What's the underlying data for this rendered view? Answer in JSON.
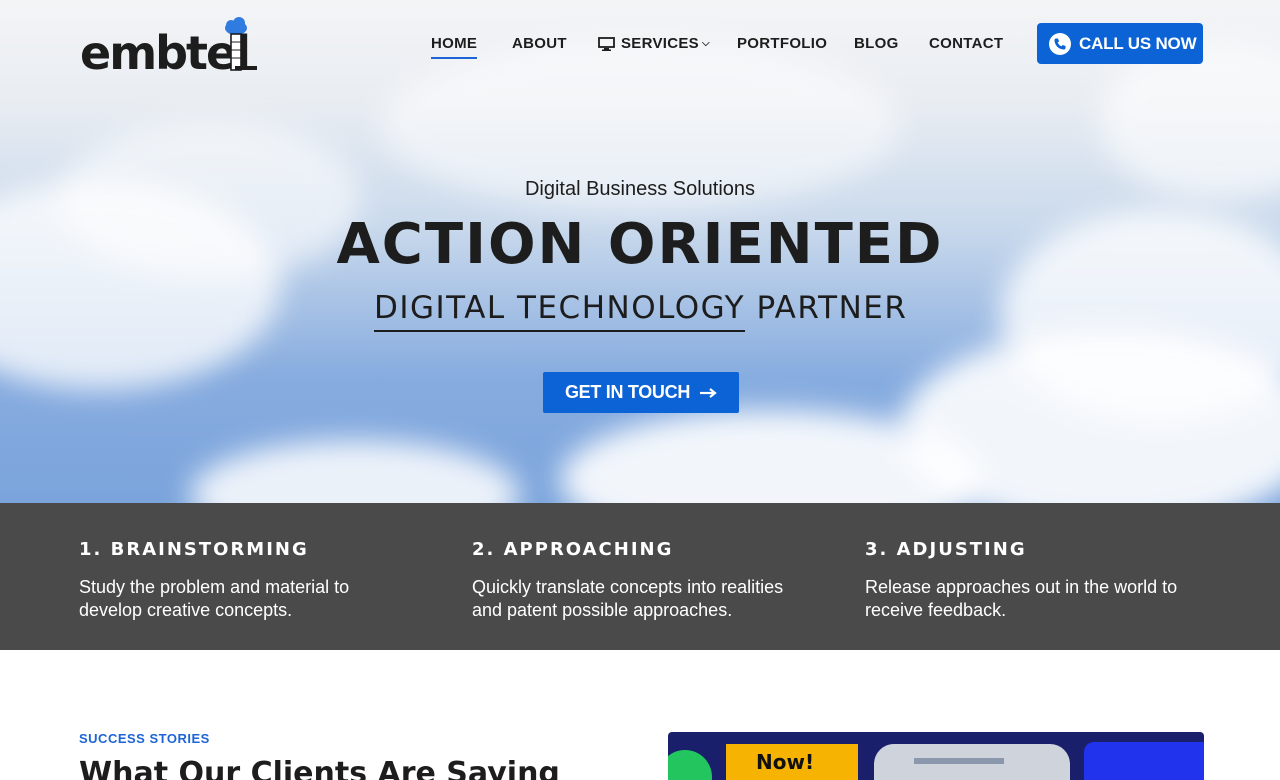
{
  "brand": {
    "name": "embtel"
  },
  "nav": {
    "items": [
      {
        "label": "HOME",
        "active": true
      },
      {
        "label": "ABOUT"
      },
      {
        "label": "SERVICES",
        "icon": "monitor-icon",
        "has_dropdown": true
      },
      {
        "label": "PORTFOLIO"
      },
      {
        "label": "BLOG"
      },
      {
        "label": "CONTACT"
      }
    ],
    "cta_label": "CALL US NOW",
    "cta_icon": "phone-icon"
  },
  "hero": {
    "subtitle": "Digital Business Solutions",
    "title": "ACTION ORIENTED",
    "line2_highlight": "DIGITAL TECHNOLOGY",
    "line2_rest": "PARTNER",
    "button_label": "GET IN TOUCH",
    "button_icon": "arrow-right-icon"
  },
  "steps": [
    {
      "title": "1. BRAINSTORMING",
      "desc_line1": "Study the problem and material to",
      "desc_line2": "develop creative concepts."
    },
    {
      "title": "2. APPROACHING",
      "desc_line1": "Quickly translate concepts into realities",
      "desc_line2": "and patent possible approaches."
    },
    {
      "title": "3. ADJUSTING",
      "desc_line1": "Release approaches out in the world to",
      "desc_line2": "receive feedback."
    }
  ],
  "testimonials": {
    "kicker": "SUCCESS STORIES",
    "title": "What Our Clients Are Saying",
    "media_caption": "Now!"
  },
  "colors": {
    "accent": "#0b63d6",
    "dark_band": "#4a4a4a",
    "text": "#1d1d1d"
  }
}
